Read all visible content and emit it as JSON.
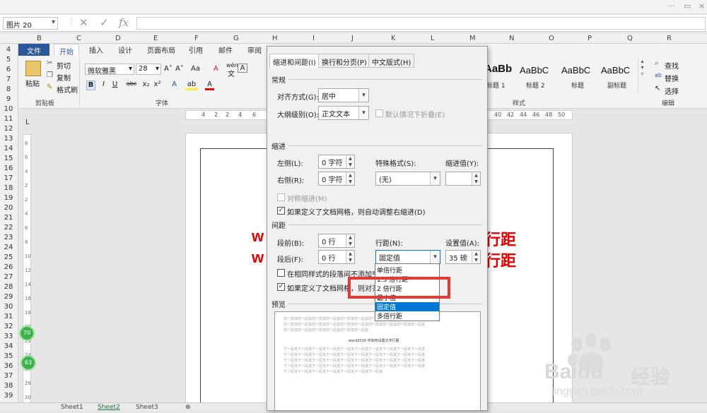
{
  "window": {
    "controls": [
      "···",
      "▭",
      "×"
    ]
  },
  "formula_bar": {
    "name_box": "图片 20",
    "cancel": "✕",
    "enter": "✓",
    "fx": "fx"
  },
  "columns": [
    "B",
    "C",
    "D",
    "E",
    "F",
    "G",
    "H",
    "I",
    "J",
    "K",
    "L",
    "M",
    "N",
    "O",
    "P",
    "Q",
    "R"
  ],
  "rows": [
    "4",
    "5",
    "6",
    "7",
    "8",
    "9",
    "10",
    "11",
    "12",
    "13",
    "14",
    "15",
    "16",
    "17",
    "18",
    "19",
    "20",
    "21",
    "22",
    "23",
    "24",
    "25",
    "26",
    "27",
    "28",
    "29",
    "30",
    "31",
    "32",
    "33",
    "34",
    "35",
    "36",
    "37",
    "38",
    "39"
  ],
  "ribbon": {
    "tabs": [
      "文件",
      "开始",
      "插入",
      "设计",
      "页面布局",
      "引用",
      "邮件",
      "审阅"
    ],
    "clipboard": {
      "paste": "粘贴",
      "cut": "剪切",
      "copy": "复制",
      "format_painter": "格式刷",
      "group": "剪贴板"
    },
    "font": {
      "name": "微软雅黑",
      "size": "28",
      "group": "字体",
      "grow": "A˄",
      "shrink": "A˅",
      "case": "Aa",
      "clear": "A",
      "bold": "B",
      "italic": "I",
      "underline": "U",
      "strike": "abc",
      "sub": "x₂",
      "sup": "x²",
      "wen": "wén",
      "wen_char": "文",
      "A": "A",
      "A_icon": "A",
      "highlight": "ab",
      "color": "A"
    },
    "styles": {
      "items": [
        {
          "preview": "AaBb",
          "name": "标题 1"
        },
        {
          "preview": "AaBbC",
          "name": "标题 2"
        },
        {
          "preview": "AaBbC",
          "name": "标题"
        },
        {
          "preview": "AaBbC",
          "name": "副标题"
        }
      ],
      "group": "样式"
    },
    "editing": {
      "find": "查找",
      "replace": "替换",
      "select": "选择",
      "group": "编辑"
    }
  },
  "ruler": [
    "4",
    "2",
    "2",
    "4",
    "6",
    "40",
    "42",
    "44",
    "46",
    "48",
    "50"
  ],
  "document": {
    "lines": [
      "w",
      "w",
      "行距",
      "行距"
    ]
  },
  "badges": [
    "70",
    "63"
  ],
  "dialog": {
    "tabs": [
      "缩进和间距(I)",
      "换行和分页(P)",
      "中文版式(H)"
    ],
    "general": {
      "title": "常规",
      "align_label": "对齐方式(G):",
      "align_value": "居中",
      "outline_label": "大纲级别(O):",
      "outline_value": "正文文本",
      "collapsed_label": "默认情况下折叠(E)"
    },
    "indent": {
      "title": "缩进",
      "left_label": "左侧(L):",
      "left_value": "0 字符",
      "right_label": "右侧(R):",
      "right_value": "0 字符",
      "special_label": "特殊格式(S):",
      "special_value": "(无)",
      "indent_value_label": "缩进值(Y):",
      "mirror_label": "对称缩进(M)",
      "auto_adjust_label": "如果定义了文档网格，则自动调整右缩进(D)"
    },
    "spacing": {
      "title": "间距",
      "before_label": "段前(B):",
      "before_value": "0 行",
      "after_label": "段后(F):",
      "after_value": "0 行",
      "line_label": "行距(N):",
      "line_value": "固定值",
      "at_label": "设置值(A):",
      "at_value": "35 磅",
      "no_space_label": "在相同样式的段落间不添加空格",
      "snap_label": "如果定义了文档网格，则对齐到"
    },
    "preview": {
      "title": "预览",
      "lines": [
        "前一段落前一段落前一段落前一段落前一段落前一段落前一段落前一段落前一段落前一段落",
        "前一段落前一段落前一段落前一段落前一段落前一段落前一段落前一段落前一段落前一段落",
        "前一段落前一段落前一段落前一段落前一段落前一段落",
        "word2016 中如何设置文字行距",
        "下一段落下一段落下一段落下一段落下一段落下一段落下一段落下一段落下一段落下一段落",
        "下一段落下一段落下一段落下一段落下一段落下一段落下一段落下一段落下一段落下一段落",
        "下一段落下一段落下一段落下一段落下一段落下一段落下一段落下一段落下一段落下一段落",
        "下一段落下一段落下一段落下一段落下一段落下一段落下一段落下一段落下一段落下一段落",
        "下一段落下一段落下一段落下一段落下一段落下一段落下一段落"
      ]
    },
    "dropdown": {
      "options": [
        "单倍行距",
        "1.5 倍行距",
        "2 倍行距",
        "最小值",
        "固定值",
        "多倍行距"
      ],
      "selected_index": 4
    }
  },
  "sheets": [
    "Sheet1",
    "Sheet2",
    "Sheet3",
    "⊕"
  ],
  "watermark": {
    "brand": "Baidu",
    "cn": "经验",
    "url": "jingyan.baidu.com"
  },
  "colors": {
    "accent": "#2b579a",
    "highlight_box": "#e53935",
    "doc_text": "#e60000",
    "selection": "#0078d7"
  }
}
